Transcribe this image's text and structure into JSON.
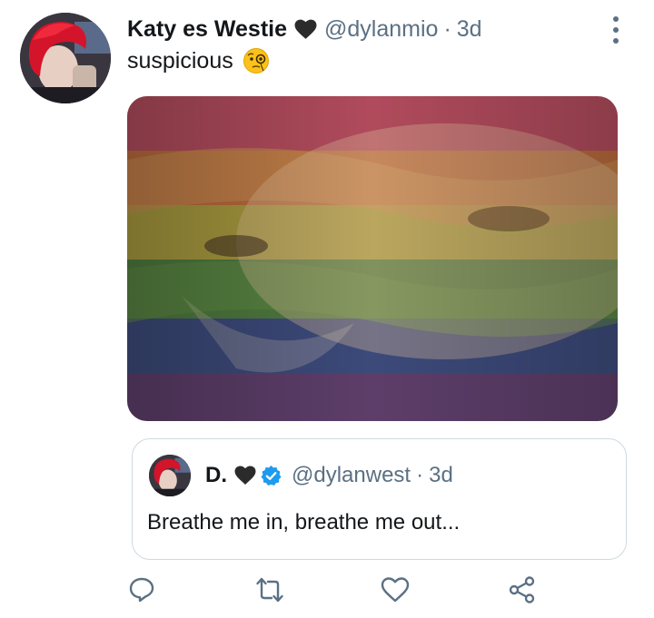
{
  "tweet": {
    "display_name": "Katy es Westie",
    "handle": "@dylanmio",
    "separator": "·",
    "time": "3d",
    "text": "suspicious",
    "emoji_icon": "face-with-monocle-icon",
    "name_badge_icon": "black-heart-icon"
  },
  "quoted_tweet": {
    "display_name": "D.",
    "name_badge_icon": "black-heart-icon",
    "verified_icon": "verified-badge-icon",
    "handle": "@dylanwest",
    "separator": "·",
    "time": "3d",
    "text": "Breathe me in, breathe me out..."
  },
  "actions": [
    {
      "icon": "reply-icon"
    },
    {
      "icon": "retweet-icon"
    },
    {
      "icon": "like-icon"
    },
    {
      "icon": "share-icon"
    }
  ],
  "colors": {
    "text_primary": "#14171a",
    "text_secondary": "#5b7083",
    "border": "#cfd9de",
    "verified": "#1d9bf0"
  }
}
